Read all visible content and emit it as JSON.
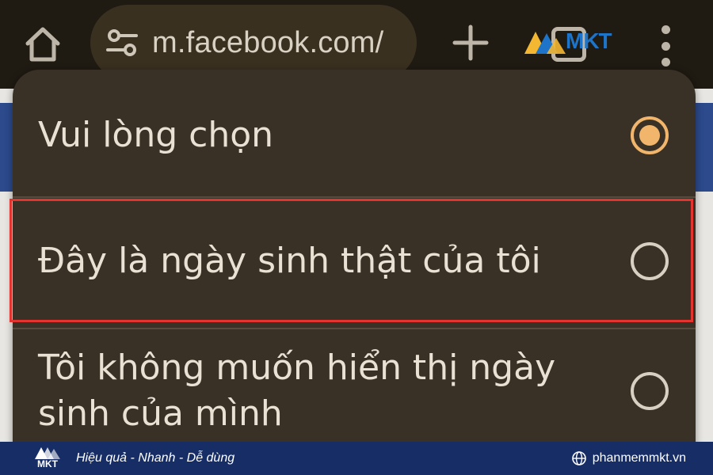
{
  "browser": {
    "url": "m.facebook.com/",
    "logo_text": "MKT"
  },
  "dialog": {
    "options": [
      {
        "label": "Vui lòng chọn",
        "selected": true
      },
      {
        "label": "Đây là ngày sinh thật của tôi",
        "selected": false
      },
      {
        "label": "Tôi không muốn hiển thị ngày sinh của mình",
        "selected": false
      }
    ]
  },
  "footer": {
    "logo_text": "MKT",
    "slogan": "Hiệu quả - Nhanh - Dễ dùng",
    "website": "phanmemmkt.vn"
  },
  "colors": {
    "accent": "#f1b56c",
    "highlight": "#e3342f",
    "dialog_bg": "#3a3126",
    "footer_bg": "#162d66"
  }
}
